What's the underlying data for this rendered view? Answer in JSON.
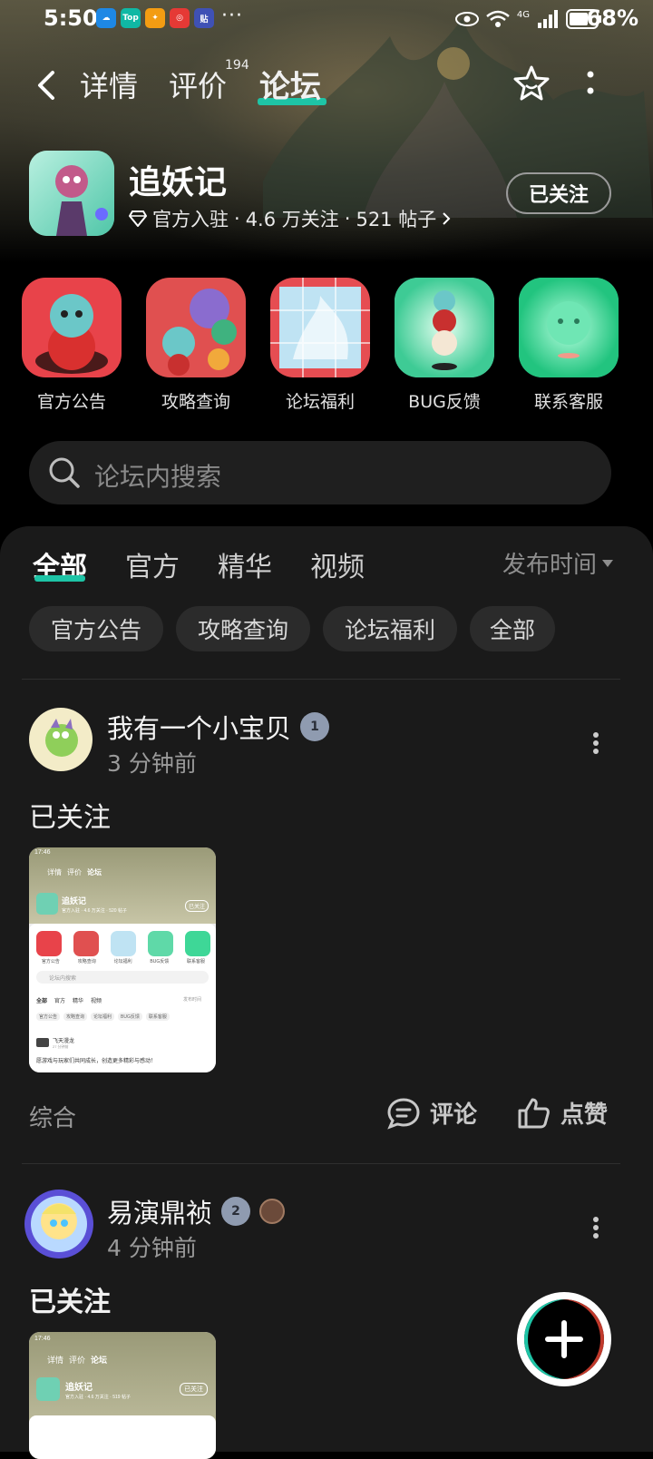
{
  "status_bar": {
    "time": "5:50",
    "notification_icons": [
      "Top",
      "贴"
    ],
    "more": "···",
    "network": "4G",
    "battery": "68%"
  },
  "nav": {
    "tabs": [
      {
        "label": "详情"
      },
      {
        "label": "评价",
        "count": "194"
      },
      {
        "label": "论坛"
      }
    ]
  },
  "game": {
    "title": "追妖记",
    "official": "官方入驻",
    "followers": "4.6 万关注",
    "posts": "521 帖子",
    "follow_label": "已关注"
  },
  "entries": [
    {
      "label": "官方公告",
      "icon": "announcement-icon"
    },
    {
      "label": "攻略查询",
      "icon": "guide-icon"
    },
    {
      "label": "论坛福利",
      "icon": "gift-icon"
    },
    {
      "label": "BUG反馈",
      "icon": "bug-icon"
    },
    {
      "label": "联系客服",
      "icon": "support-icon"
    }
  ],
  "search": {
    "placeholder": "论坛内搜索"
  },
  "filters": {
    "tabs": [
      "全部",
      "官方",
      "精华",
      "视频"
    ],
    "sort": "发布时间",
    "chips": [
      "官方公告",
      "攻略查询",
      "论坛福利",
      "全部"
    ]
  },
  "posts": [
    {
      "user": "我有一个小宝贝",
      "level": "1",
      "time": "3 分钟前",
      "text": "已关注",
      "tag": "综合",
      "comment": "评论",
      "like": "点赞",
      "thumb": {
        "time": "17:46",
        "tabs": [
          "详情",
          "评价",
          "论坛"
        ],
        "title": "追妖记",
        "meta": "官方入驻 · 4.6 万关注 · 520 帖子",
        "follow": "已关注",
        "entries": [
          "官方公告",
          "攻略查询",
          "论坛福利",
          "BUG反馈",
          "联系客服"
        ],
        "search": "论坛内搜索",
        "filters": [
          "全部",
          "官方",
          "精华",
          "视频"
        ],
        "sort": "发布时间",
        "chips": [
          "官方公告",
          "攻略查询",
          "论坛福利",
          "BUG反馈",
          "联系客服"
        ],
        "post_user": "飞天漫龙",
        "post_time": "27 分钟前",
        "post_text": "愿游戏与玩家们共同成长，创造更多精彩与感动！"
      }
    },
    {
      "user": "易演鼎祯",
      "level": "2",
      "time": "4 分钟前",
      "text": "已关注",
      "thumb": {
        "time": "17:46",
        "tabs": [
          "详情",
          "评价",
          "论坛"
        ],
        "title": "追妖记",
        "meta": "官方入驻 · 4.6 万关注 · 519 帖子",
        "follow": "已关注"
      }
    }
  ],
  "colors": {
    "accent": "#1ec4a6",
    "panel": "#1a1a1a",
    "chip": "#2b2b2b"
  }
}
